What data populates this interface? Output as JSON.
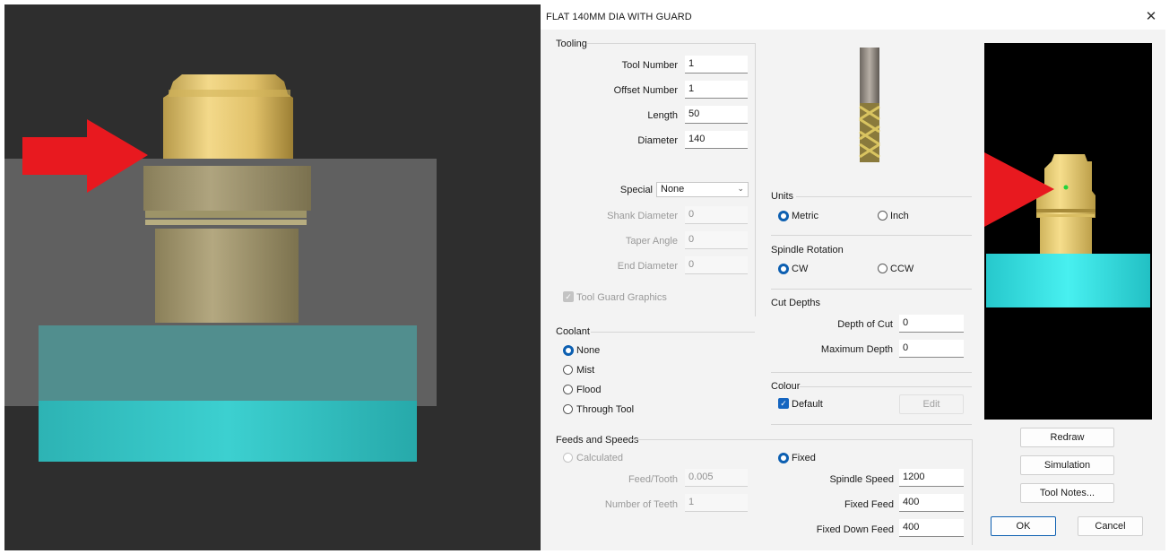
{
  "window": {
    "title": "FLAT 140MM DIA WITH GUARD",
    "close": "✕"
  },
  "tooling": {
    "group": "Tooling",
    "tool_number_label": "Tool Number",
    "tool_number": "1",
    "offset_number_label": "Offset Number",
    "offset_number": "1",
    "length_label": "Length",
    "length": "50",
    "diameter_label": "Diameter",
    "diameter": "140",
    "special_label": "Special",
    "special": "None",
    "shank_diameter_label": "Shank Diameter",
    "shank_diameter": "0",
    "taper_angle_label": "Taper Angle",
    "taper_angle": "0",
    "end_diameter_label": "End Diameter",
    "end_diameter": "0",
    "guard_graphics_label": "Tool Guard Graphics"
  },
  "coolant": {
    "group": "Coolant",
    "options": [
      "None",
      "Mist",
      "Flood",
      "Through Tool"
    ],
    "selected": "None"
  },
  "units": {
    "group": "Units",
    "metric": "Metric",
    "inch": "Inch",
    "selected": "Metric"
  },
  "spindle": {
    "group": "Spindle Rotation",
    "cw": "CW",
    "ccw": "CCW",
    "selected": "CW"
  },
  "cut_depths": {
    "group": "Cut Depths",
    "depth_of_cut_label": "Depth of Cut",
    "depth_of_cut": "0",
    "max_depth_label": "Maximum Depth",
    "max_depth": "0"
  },
  "colour": {
    "group": "Colour",
    "default_label": "Default",
    "edit": "Edit"
  },
  "feeds": {
    "group": "Feeds and Speeds",
    "calculated": "Calculated",
    "fixed": "Fixed",
    "selected": "Fixed",
    "feed_tooth_label": "Feed/Tooth",
    "feed_tooth": "0.005",
    "teeth_label": "Number of Teeth",
    "teeth": "1",
    "spindle_speed_label": "Spindle Speed",
    "spindle_speed": "1200",
    "fixed_feed_label": "Fixed Feed",
    "fixed_feed": "400",
    "fixed_down_feed_label": "Fixed Down Feed",
    "fixed_down_feed": "400"
  },
  "buttons": {
    "redraw": "Redraw",
    "simulation": "Simulation",
    "tool_notes": "Tool Notes...",
    "ok": "OK",
    "cancel": "Cancel"
  },
  "colors": {
    "accent": "#0c5fb1",
    "arrow": "#e8191f",
    "stock": "#33e0e6",
    "tool": "#e9c96a"
  }
}
